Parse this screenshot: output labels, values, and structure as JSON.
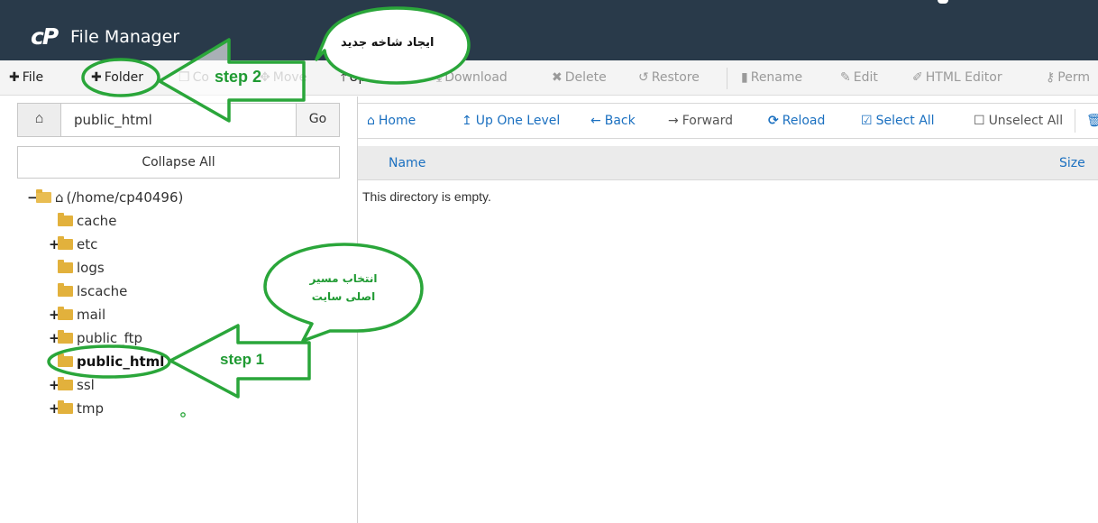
{
  "app": {
    "logo": "cP",
    "title": "File Manager"
  },
  "toolbar": {
    "file": "File",
    "folder": "Folder",
    "copy": "Co",
    "move": "Move",
    "upload": "Upload",
    "download": "Download",
    "delete": "Delete",
    "restore": "Restore",
    "rename": "Rename",
    "edit": "Edit",
    "html_editor": "HTML Editor",
    "permissions": "Perm"
  },
  "left": {
    "path_value": "public_html",
    "go_label": "Go",
    "collapse_label": "Collapse All",
    "tree": {
      "root": "(/home/cp40496)",
      "items": [
        {
          "name": "cache",
          "toggle": ""
        },
        {
          "name": "etc",
          "toggle": "+"
        },
        {
          "name": "logs",
          "toggle": ""
        },
        {
          "name": "lscache",
          "toggle": ""
        },
        {
          "name": "mail",
          "toggle": "+"
        },
        {
          "name": "public_ftp",
          "toggle": "+"
        },
        {
          "name": "public_html",
          "toggle": ""
        },
        {
          "name": "ssl",
          "toggle": "+"
        },
        {
          "name": "tmp",
          "toggle": "+"
        }
      ]
    }
  },
  "nav": {
    "home": "Home",
    "up": "Up One Level",
    "back": "Back",
    "forward": "Forward",
    "reload": "Reload",
    "select_all": "Select All",
    "unselect_all": "Unselect All"
  },
  "table": {
    "col_name": "Name",
    "col_size": "Size",
    "empty": "This directory is empty."
  },
  "annotations": {
    "step1": "step 1",
    "step2": "step 2",
    "bubble_new_folder": "ایجاد شاخه جدید",
    "bubble_select_line1": "انتخاب مسیر",
    "bubble_select_line2": "اصلی سایت"
  },
  "colors": {
    "header_bg": "#293a4a",
    "link_blue": "#1b70c0",
    "annotation_green": "#2aa63a"
  }
}
